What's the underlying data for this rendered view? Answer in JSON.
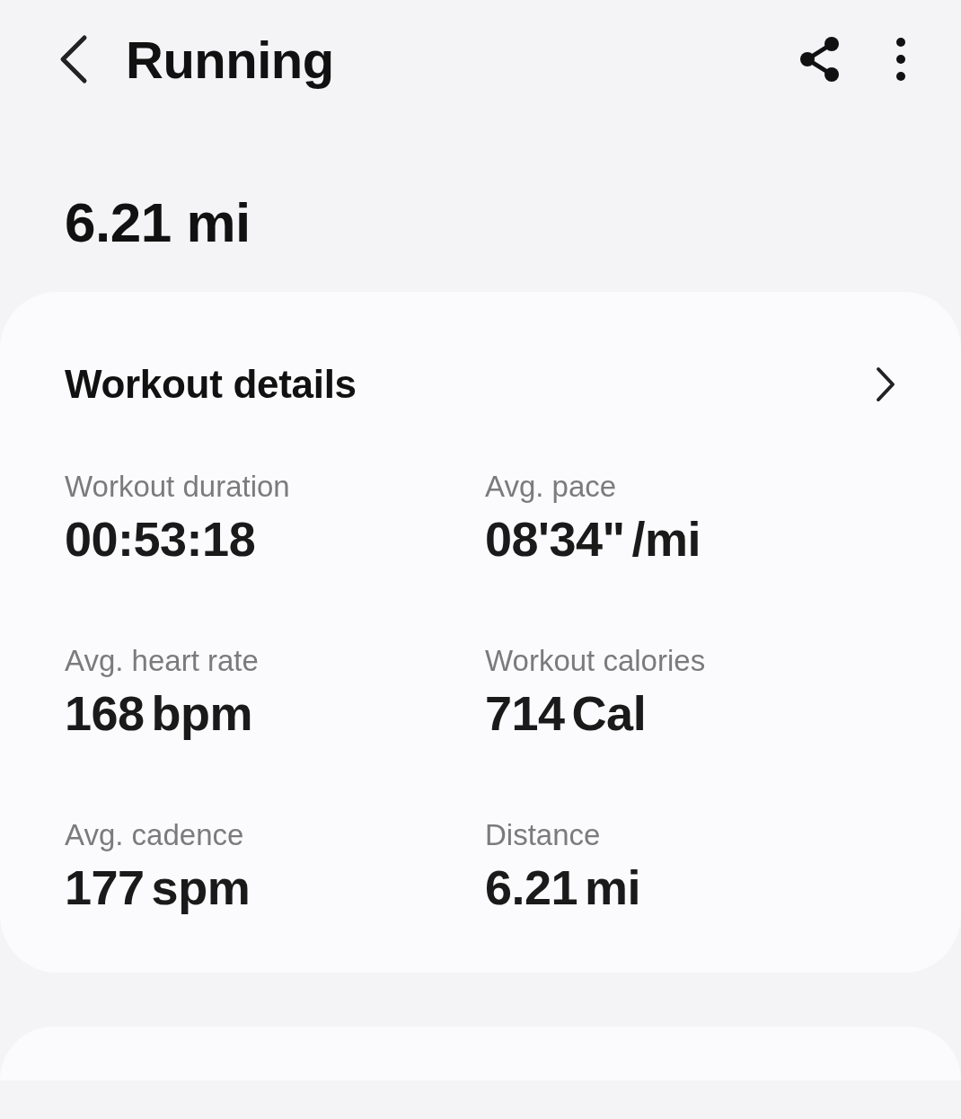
{
  "header": {
    "title": "Running"
  },
  "summary": {
    "distance": "6.21 mi"
  },
  "workout_details": {
    "title": "Workout details",
    "stats": [
      {
        "label": "Workout duration",
        "value": "00:53:18"
      },
      {
        "label": "Avg. pace",
        "value": "08'34\"",
        "unit": "/mi"
      },
      {
        "label": "Avg. heart rate",
        "value": "168",
        "unit": "bpm"
      },
      {
        "label": "Workout calories",
        "value": "714",
        "unit": "Cal"
      },
      {
        "label": "Avg. cadence",
        "value": "177",
        "unit": "spm"
      },
      {
        "label": "Distance",
        "value": "6.21",
        "unit": "mi"
      }
    ]
  }
}
